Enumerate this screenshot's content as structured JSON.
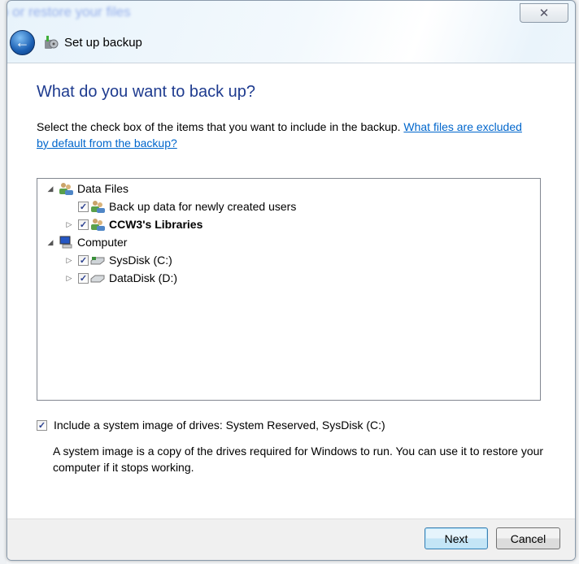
{
  "background_window": {
    "title_fragment": "p or restore your files"
  },
  "window": {
    "title": "Set up backup",
    "close_icon": "close-icon",
    "back_icon": "back-arrow-icon"
  },
  "page": {
    "heading": "What do you want to back up?",
    "instruction": "Select the check box of the items that you want to include in the backup. ",
    "link": "What files are excluded by default from the backup?"
  },
  "tree": {
    "items": [
      {
        "label": "Data Files",
        "expanded": true,
        "checkbox": false,
        "icon": "users-icon",
        "level": 0
      },
      {
        "label": "Back up data for newly created users",
        "checked": true,
        "icon": "users-icon",
        "level": 1
      },
      {
        "label": "CCW3's Libraries",
        "checked": true,
        "expandable": true,
        "bold": true,
        "icon": "users-icon",
        "level": 1
      },
      {
        "label": "Computer",
        "expanded": true,
        "checkbox": false,
        "icon": "computer-icon",
        "level": 0
      },
      {
        "label": "SysDisk (C:)",
        "checked": true,
        "expandable": true,
        "icon": "system-drive-icon",
        "level": 1
      },
      {
        "label": "DataDisk (D:)",
        "checked": true,
        "expandable": true,
        "icon": "drive-icon",
        "level": 1
      }
    ]
  },
  "system_image": {
    "checked": true,
    "label": "Include a system image of drives: System Reserved, SysDisk (C:)",
    "description": "A system image is a copy of the drives required for Windows to run. You can use it to restore your computer if it stops working."
  },
  "buttons": {
    "next": "Next",
    "cancel": "Cancel"
  },
  "colors": {
    "heading": "#1e3b8f",
    "link": "#0066cc"
  }
}
